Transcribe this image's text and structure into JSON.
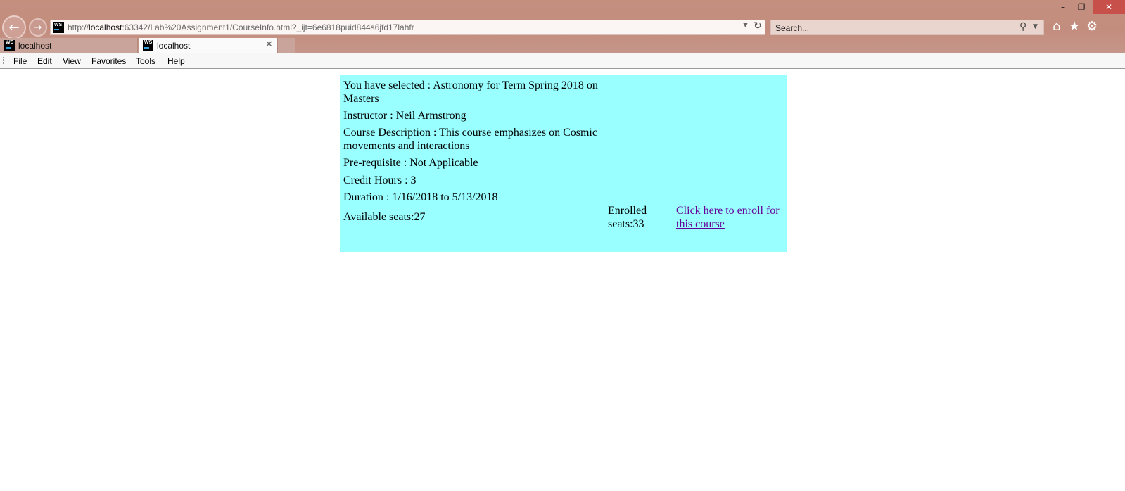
{
  "window": {
    "minimize_glyph": "–",
    "restore_glyph": "❐",
    "close_glyph": "✕"
  },
  "address_bar": {
    "site_icon_text": "WS",
    "url_prefix": "http://",
    "url_host": "localhost",
    "url_rest": ":63342/Lab%20Assignment1/CourseInfo.html?_ijt=6e6818puid844s6jfd17lahfr"
  },
  "search": {
    "placeholder": "Search..."
  },
  "tabs": [
    {
      "label": "localhost",
      "icon_text": "WS",
      "active": false
    },
    {
      "label": "localhost",
      "icon_text": "WS",
      "active": true
    }
  ],
  "menu": {
    "items": [
      "File",
      "Edit",
      "View",
      "Favorites",
      "Tools",
      "Help"
    ]
  },
  "course": {
    "selected_line": "You have selected : Astronomy for Term Spring 2018 on Masters",
    "instructor_line": "Instructor : Neil Armstrong",
    "description_line": "Course Description : This course emphasizes on Cosmic movements and interactions",
    "prerequisite_line": "Pre-requisite : Not Applicable",
    "credit_hours_line": "Credit Hours : 3",
    "duration_line": "Duration : 1/16/2018 to 5/13/2018",
    "available_seats": "Available seats:27",
    "enrolled_seats": "Enrolled seats:33",
    "enroll_link": "Click here to enroll for this course"
  },
  "colors": {
    "chrome_bg": "#c38d7e",
    "panel_bg": "#99ffff",
    "link_visited": "#660099"
  },
  "icons": {
    "back": "back-arrow-icon",
    "forward": "forward-arrow-icon",
    "refresh": "refresh-icon",
    "search": "search-icon",
    "home": "home-icon",
    "favorites": "star-icon",
    "settings": "gear-icon"
  }
}
